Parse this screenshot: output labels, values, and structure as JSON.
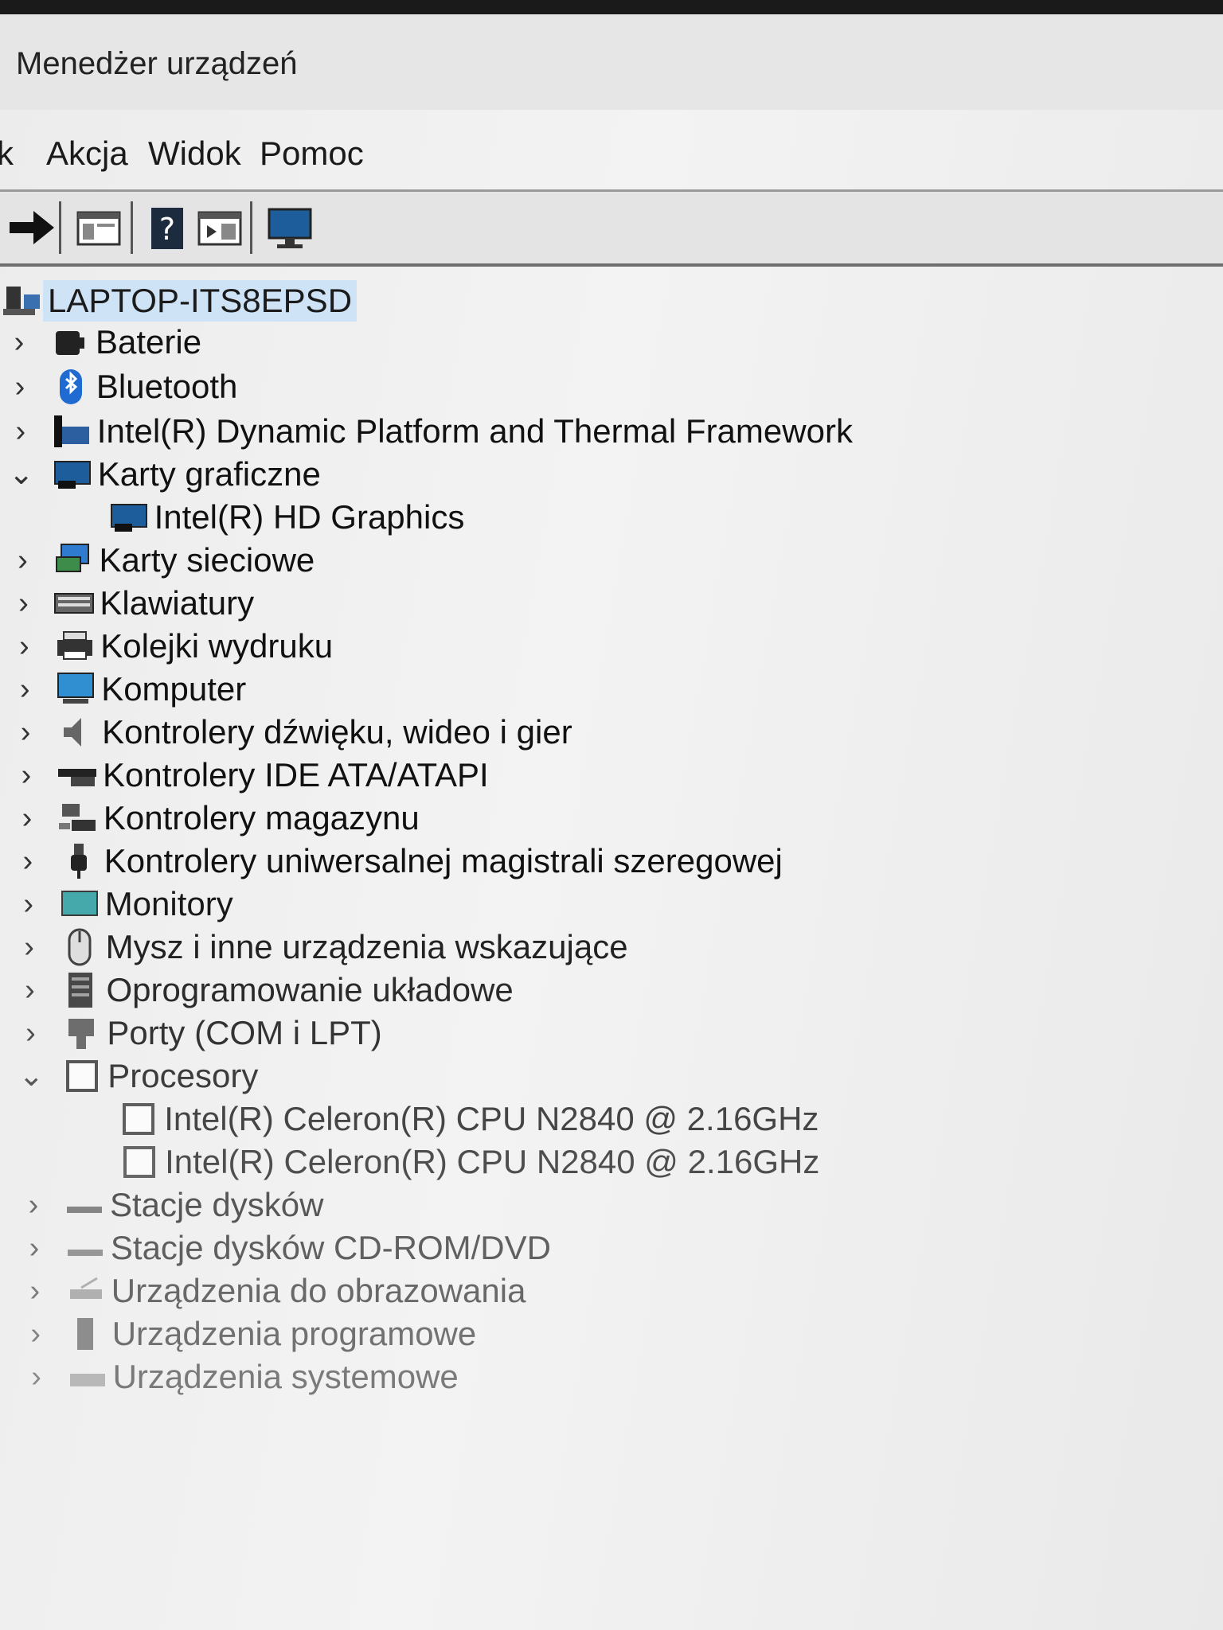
{
  "window": {
    "title": "Menedżer urządzeń"
  },
  "menu": {
    "items": [
      "k",
      "Akcja",
      "Widok",
      "Pomoc"
    ]
  },
  "toolbar": {
    "icons": [
      "forward-arrow-icon",
      "properties-icon",
      "help-icon",
      "view-icon",
      "monitor-icon"
    ]
  },
  "tree": {
    "root": "LAPTOP-ITS8EPSD",
    "items": [
      {
        "label": "Baterie",
        "state": "collapsed",
        "icon": "battery-icon"
      },
      {
        "label": "Bluetooth",
        "state": "collapsed",
        "icon": "bluetooth-icon"
      },
      {
        "label": "Intel(R) Dynamic Platform and Thermal Framework",
        "state": "collapsed",
        "icon": "thermal-icon"
      },
      {
        "label": "Karty graficzne",
        "state": "expanded",
        "icon": "display-adapter-icon"
      },
      {
        "label": "Intel(R) HD Graphics",
        "state": "child",
        "icon": "display-adapter-icon"
      },
      {
        "label": "Karty sieciowe",
        "state": "collapsed",
        "icon": "network-adapter-icon"
      },
      {
        "label": "Klawiatury",
        "state": "collapsed",
        "icon": "keyboard-icon"
      },
      {
        "label": "Kolejki wydruku",
        "state": "collapsed",
        "icon": "printer-icon"
      },
      {
        "label": "Komputer",
        "state": "collapsed",
        "icon": "computer-icon"
      },
      {
        "label": "Kontrolery dźwięku, wideo i gier",
        "state": "collapsed",
        "icon": "speaker-icon"
      },
      {
        "label": "Kontrolery IDE ATA/ATAPI",
        "state": "collapsed",
        "icon": "ide-controller-icon"
      },
      {
        "label": "Kontrolery magazynu",
        "state": "collapsed",
        "icon": "storage-controller-icon"
      },
      {
        "label": "Kontrolery uniwersalnej magistrali szeregowej",
        "state": "collapsed",
        "icon": "usb-icon"
      },
      {
        "label": "Monitory",
        "state": "collapsed",
        "icon": "monitor-icon"
      },
      {
        "label": "Mysz i inne urządzenia wskazujące",
        "state": "collapsed",
        "icon": "mouse-icon"
      },
      {
        "label": "Oprogramowanie układowe",
        "state": "collapsed",
        "icon": "firmware-icon"
      },
      {
        "label": "Porty (COM i LPT)",
        "state": "collapsed",
        "icon": "port-icon"
      },
      {
        "label": "Procesory",
        "state": "expanded",
        "icon": "processor-icon"
      },
      {
        "label": "Intel(R) Celeron(R) CPU  N2840  @ 2.16GHz",
        "state": "child",
        "icon": "processor-icon"
      },
      {
        "label": "Intel(R) Celeron(R) CPU  N2840  @ 2.16GHz",
        "state": "child",
        "icon": "processor-icon"
      },
      {
        "label": "Stacje dysków",
        "state": "collapsed",
        "icon": "disk-drive-icon"
      },
      {
        "label": "Stacje dysków CD-ROM/DVD",
        "state": "collapsed",
        "icon": "cdrom-icon"
      },
      {
        "label": "Urządzenia do obrazowania",
        "state": "collapsed",
        "icon": "imaging-icon"
      },
      {
        "label": "Urządzenia programowe",
        "state": "collapsed",
        "icon": "software-device-icon"
      },
      {
        "label": "Urządzenia systemowe",
        "state": "collapsed",
        "icon": "system-device-icon"
      }
    ]
  }
}
